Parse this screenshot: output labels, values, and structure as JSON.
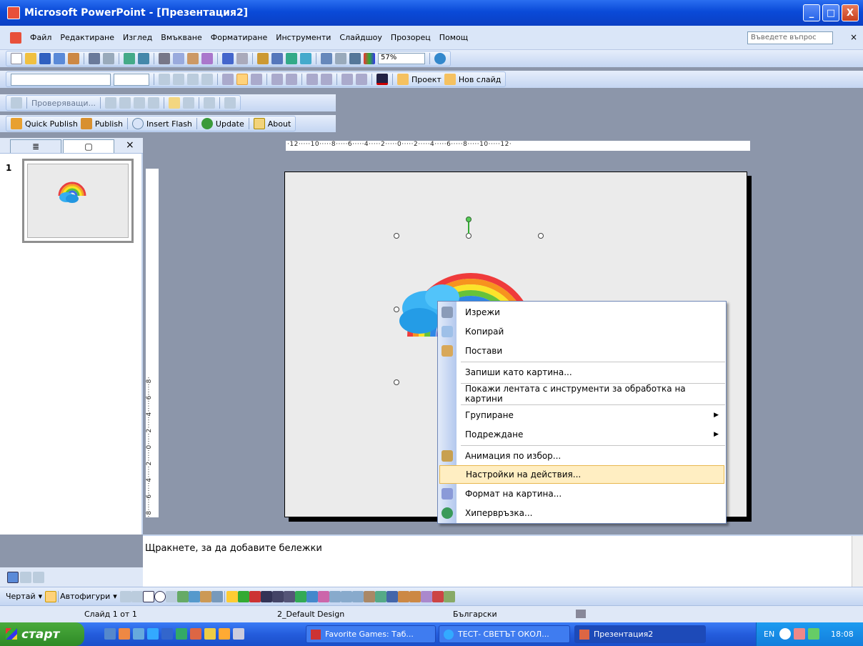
{
  "window": {
    "title": "Microsoft PowerPoint - [Презентация2]",
    "buttons": {
      "minimize": "_",
      "maximize": "□",
      "close": "X"
    }
  },
  "menubar": {
    "items": [
      "Файл",
      "Редактиране",
      "Изглед",
      "Вмъкване",
      "Форматиране",
      "Инструменти",
      "Слайдшоу",
      "Прозорец",
      "Помощ"
    ],
    "ask_placeholder": "Въведете въпрос",
    "close": "×"
  },
  "standard_toolbar": {
    "zoom": "57%"
  },
  "format_toolbar": {
    "design_label": "Проект",
    "new_slide_label": "Нов слайд"
  },
  "review_toolbar": {
    "reviewers_label": "Проверяващи..."
  },
  "addin_toolbar": {
    "items": [
      "Quick Publish",
      "Publish",
      "Insert Flash",
      "Update",
      "About"
    ]
  },
  "left_pane": {
    "close": "×",
    "slide_number": "1"
  },
  "ruler": {
    "horizontal": "·12·····10·····8·····6·····4·····2·····0·····2·····4·····6·····8·····10·····12·",
    "vertical": "·8·····6·····4·····2·····0·····2·····4·····6·····8·"
  },
  "context_menu": {
    "items": [
      {
        "label": "Изрежи",
        "icon": "scissors-icon"
      },
      {
        "label": "Копирай",
        "icon": "copy-icon"
      },
      {
        "label": "Постави",
        "icon": "paste-icon"
      },
      {
        "label": "Запиши като картина...",
        "icon": ""
      },
      {
        "label": "Покажи лентата с инструменти за обработка на картини",
        "icon": ""
      },
      {
        "label": "Групиране",
        "icon": "",
        "submenu": true
      },
      {
        "label": "Подреждане",
        "icon": "",
        "submenu": true
      },
      {
        "label": "Анимация по избор...",
        "icon": "animation-icon"
      },
      {
        "label": "Настройки на действия...",
        "icon": "",
        "highlighted": true
      },
      {
        "label": "Формат на картина...",
        "icon": "format-picture-icon"
      },
      {
        "label": "Хипервръзка...",
        "icon": "hyperlink-icon"
      }
    ]
  },
  "notes": {
    "placeholder": "Щракнете, за да добавите бележки"
  },
  "drawing_toolbar": {
    "draw_label": "Чертай",
    "autoshapes_label": "Автофигури"
  },
  "statusbar": {
    "slide": "Слайд 1 от 1",
    "design": "2_Default Design",
    "language": "Български"
  },
  "taskbar": {
    "start": "старт",
    "tasks": [
      "Favorite Games: Таб...",
      "ТЕСТ- СВЕТЪТ ОКОЛ...",
      "Презентация2"
    ],
    "tray": {
      "lang": "EN",
      "time": "18:08"
    }
  }
}
